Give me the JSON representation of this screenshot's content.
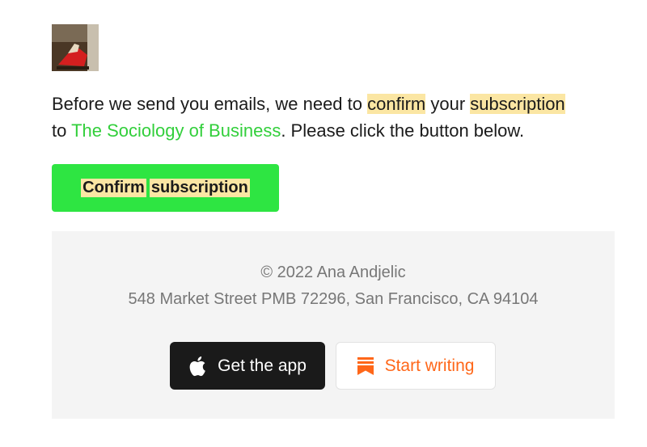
{
  "intro": {
    "before": "Before we send you emails, we need to ",
    "hl1": "confirm",
    "mid": " your ",
    "hl2": "subscription",
    "to": " to ",
    "publication": "The Sociology of Business",
    "after": ". Please click the button below."
  },
  "confirm_button": {
    "word1": "Confirm",
    "word2": "subscription"
  },
  "footer": {
    "copyright": "© 2022 Ana Andjelic",
    "address": "548 Market Street PMB 72296, San Francisco, CA 94104",
    "app_button": {
      "label": "Get the app",
      "icon": "apple-icon"
    },
    "write_button": {
      "label": "Start writing",
      "icon": "substack-icon"
    }
  },
  "colors": {
    "accent_green": "#2ee542",
    "link_green": "#32cf3b",
    "highlight": "#fbe6a3",
    "substack_orange": "#ff6719"
  }
}
